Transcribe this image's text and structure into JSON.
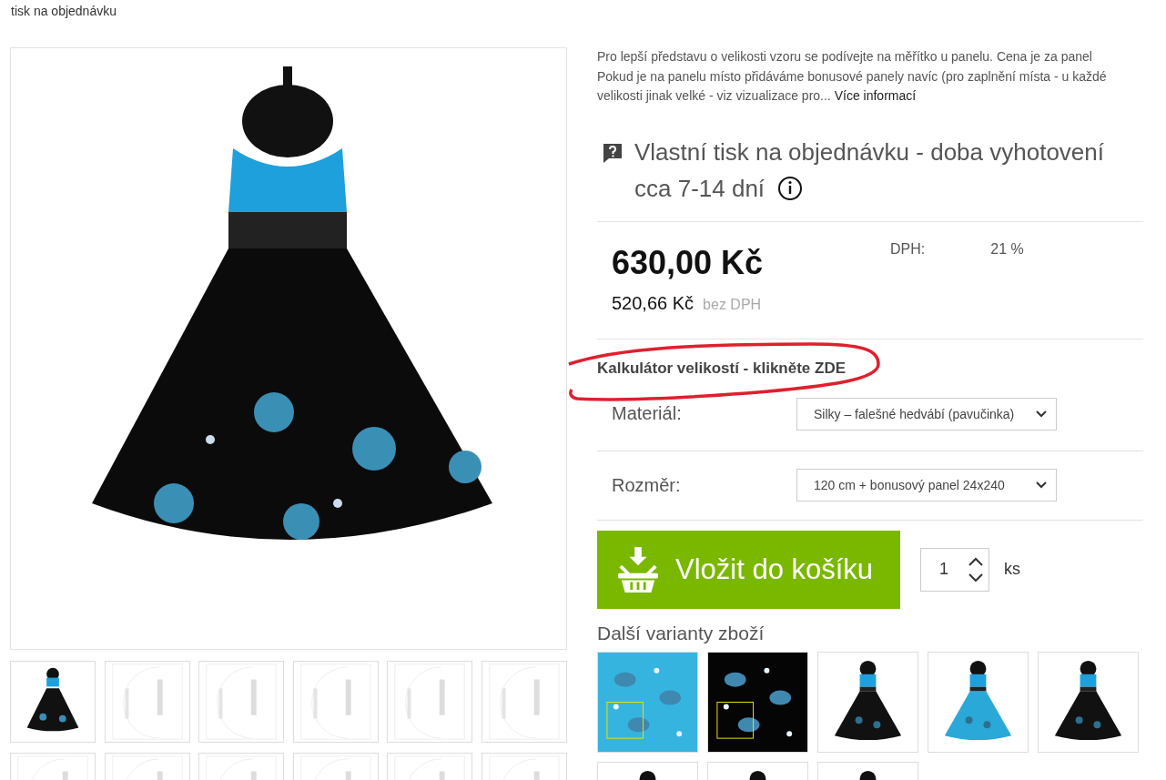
{
  "breadcrumb": "tisk na objednávku",
  "description": {
    "text": "Pro lepší představu o velikosti vzoru se podívejte na měřítko u panelu. Cena je za panel Pokud je na panelu místo přidáváme bonusové panely navíc  (pro zaplnění místa - u každé velikosti jinak velké - viz vizualizace pro...",
    "link": "Více informací"
  },
  "availability": "Vlastní tisk na objednávku - doba vyhotovení cca 7-14 dní",
  "price": {
    "total": "630,00 Kč",
    "net": "520,66 Kč",
    "net_label": "bez DPH",
    "vat_label": "DPH:",
    "vat": "21 %"
  },
  "size_calculator": "Kalkulátor velikostí - klikněte ZDE",
  "options": [
    {
      "label": "Materiál:",
      "value": "Silky – falešné hedvábí (pavučinka)"
    },
    {
      "label": "Rozměr:",
      "value": "120 cm + bonusový panel 24x240"
    }
  ],
  "add_to_cart": {
    "label": "Vložit do košíku",
    "quantity": "1",
    "unit": "ks"
  },
  "variants": {
    "title": "Další varianty zboží"
  }
}
